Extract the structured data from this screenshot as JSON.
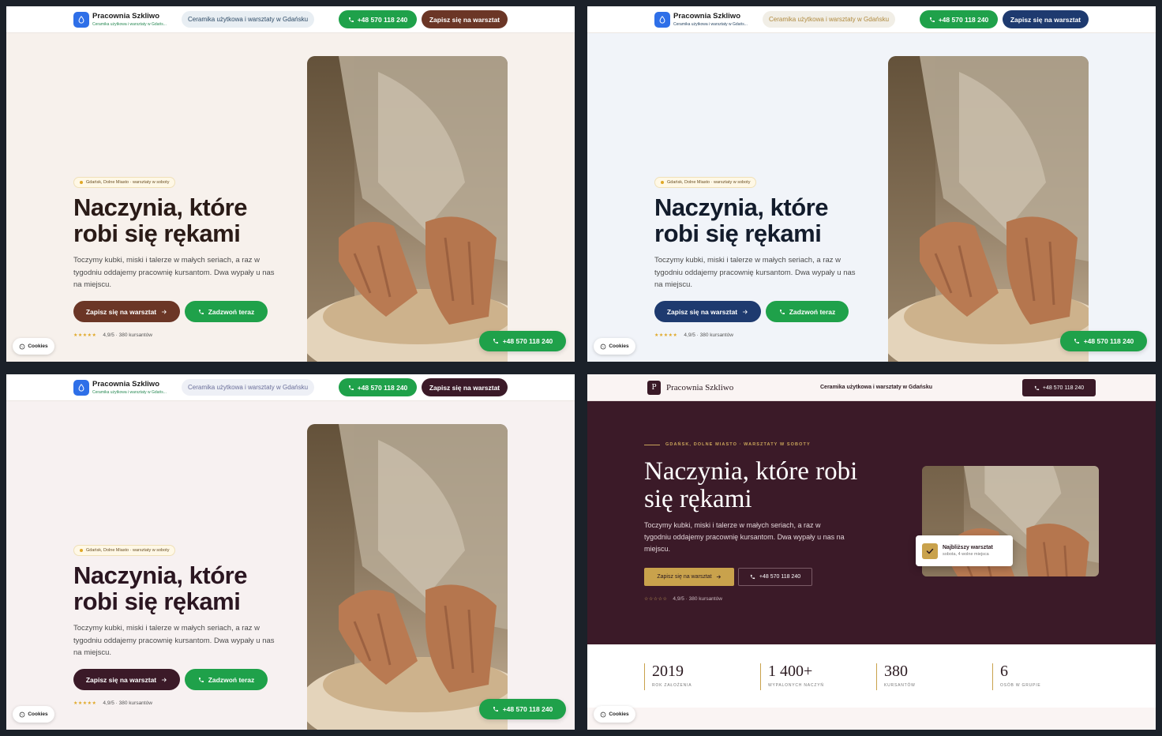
{
  "brand": {
    "name": "Pracownia Szkliwo",
    "tagline": "Ceramika użytkowa i warsztaty w Gdańsku",
    "tagline_short": "Ceramika użytkowa i warsztaty w Gdańs..."
  },
  "header": {
    "phone": "+48 570 118 240",
    "cta": "Zapisz się na warsztat"
  },
  "hero": {
    "location": "Gdańsk, Dolne Miasto · warsztaty w soboty",
    "title": "Naczynia, które robi się rękami",
    "lead": "Toczymy kubki, miski i talerze w małych seriach, a raz w tygodniu oddajemy pracownię kursantom. Dwa wypały u nas na miejscu.",
    "cta_main": "Zapisz się na warsztat",
    "cta_call": "Zadzwoń teraz",
    "stars": "★★★★★",
    "rating": "4,9/5 · 380 kursantów"
  },
  "floating_call": "+48 570 118 240",
  "cookies": "Cookies",
  "variant_d": {
    "eyebrow": "GDAŃSK, DOLNE MIASTO · WARSZTATY W SOBOTY",
    "title": "Naczynia, które robi się rękami",
    "stars": "☆☆☆☆☆",
    "card_title": "Najbliższy warsztat",
    "card_sub": "sobota, 4 wolne miejsca",
    "stats": [
      {
        "value": "2019",
        "label": "ROK ZAŁOŻENIA"
      },
      {
        "value": "1 400+",
        "label": "WYPALONYCH NACZYŃ"
      },
      {
        "value": "380",
        "label": "KURSANTÓW"
      },
      {
        "value": "6",
        "label": "OSÓB W GRUPIE"
      }
    ]
  },
  "themes": {
    "a_accent": "#6b3626",
    "b_accent": "#1e3a6f",
    "c_accent": "#3b1a28",
    "a_title": "#2a1b17",
    "b_title": "#131c2c",
    "c_title": "#2b1621",
    "phone_green": "#1fa14a",
    "d_burgundy": "#3b1a28",
    "d_gold": "#c9a24c"
  }
}
